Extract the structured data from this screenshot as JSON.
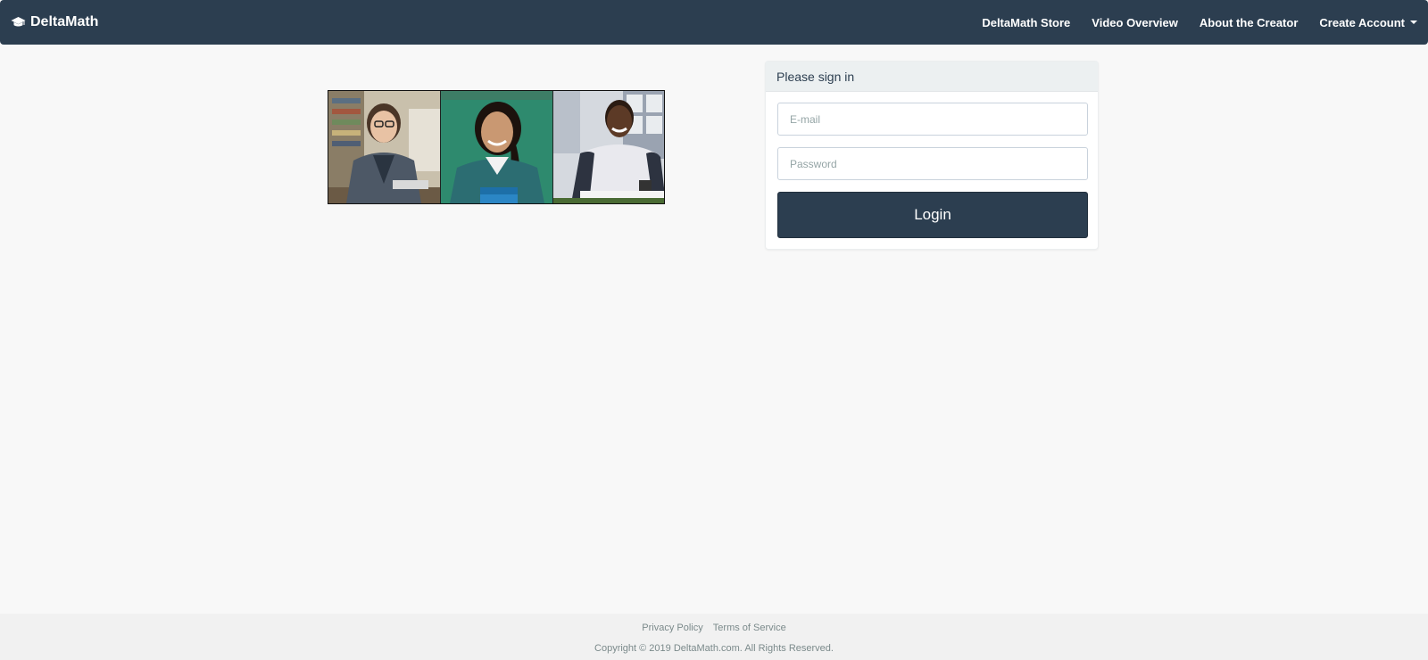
{
  "navbar": {
    "brand": "DeltaMath",
    "brand_icon": "graduation-cap-icon",
    "links": [
      {
        "label": "DeltaMath Store"
      },
      {
        "label": "Video Overview"
      },
      {
        "label": "About the Creator"
      },
      {
        "label": "Create Account",
        "dropdown": true
      }
    ]
  },
  "signin": {
    "heading": "Please sign in",
    "email_placeholder": "E-mail",
    "email_value": "",
    "password_placeholder": "Password",
    "password_value": "",
    "login_label": "Login"
  },
  "footer": {
    "links": [
      "Privacy Policy",
      "Terms of Service"
    ],
    "copyright": "Copyright © 2019 DeltaMath.com. All Rights Reserved."
  },
  "colors": {
    "navbar_bg": "#2c3e50",
    "panel_heading_bg": "#ecf0f1",
    "page_bg": "#f8f8f8",
    "accent": "#2c3e50"
  }
}
